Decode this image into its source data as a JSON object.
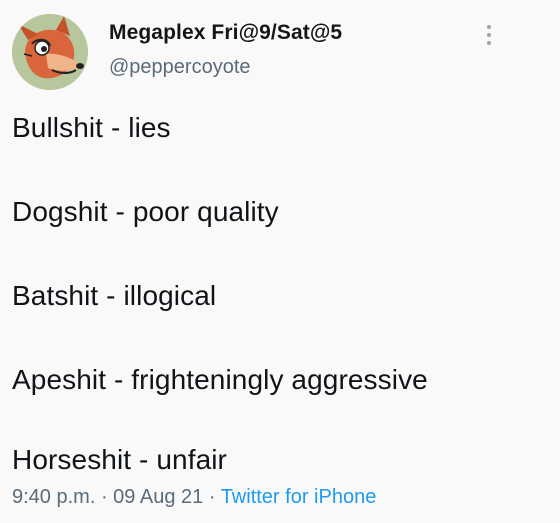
{
  "header": {
    "display_name": "Megaplex Fri@9/Sat@5",
    "handle": "@peppercoyote"
  },
  "body_lines": [
    "Bullshit - lies",
    "Dogshit - poor quality",
    "Batshit - illogical",
    "Apeshit - frighteningly aggressive",
    "Horseshit - unfair"
  ],
  "meta": {
    "time": "9:40 p.m.",
    "sep1": " · ",
    "date": "09 Aug 21",
    "sep2": " · ",
    "source": "Twitter for iPhone"
  },
  "icons": {
    "avatar": "coyote-cartoon-avatar",
    "more": "more-options-vertical-icon"
  },
  "colors": {
    "source_link": "#1d9bf0",
    "secondary_text": "#5b6b7a",
    "primary_text": "#101418"
  }
}
